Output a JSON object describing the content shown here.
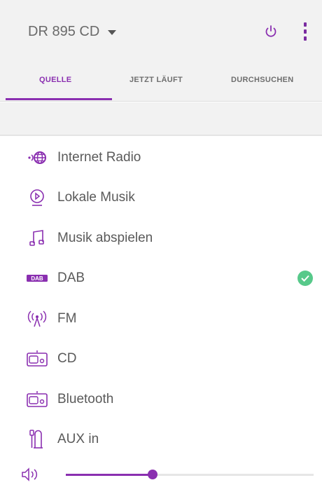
{
  "header": {
    "device_name": "DR 895 CD"
  },
  "tabs": [
    {
      "label": "QUELLE",
      "active": true
    },
    {
      "label": "JETZT LÄUFT",
      "active": false
    },
    {
      "label": "DURCHSUCHEN",
      "active": false
    }
  ],
  "sources": [
    {
      "label": "Internet Radio",
      "icon": "internet-radio-icon",
      "selected": false
    },
    {
      "label": "Lokale Musik",
      "icon": "local-music-icon",
      "selected": false
    },
    {
      "label": "Musik abspielen",
      "icon": "music-note-icon",
      "selected": false
    },
    {
      "label": "DAB",
      "icon": "dab-icon",
      "selected": true
    },
    {
      "label": "FM",
      "icon": "fm-icon",
      "selected": false
    },
    {
      "label": "CD",
      "icon": "cd-player-icon",
      "selected": false
    },
    {
      "label": "Bluetooth",
      "icon": "bluetooth-player-icon",
      "selected": false
    },
    {
      "label": "AUX in",
      "icon": "aux-in-icon",
      "selected": false
    }
  ],
  "volume": {
    "level_percent": 35
  },
  "colors": {
    "accent": "#8a2fb0",
    "check": "#57c98a",
    "bar_bg": "#f2f2f2"
  }
}
